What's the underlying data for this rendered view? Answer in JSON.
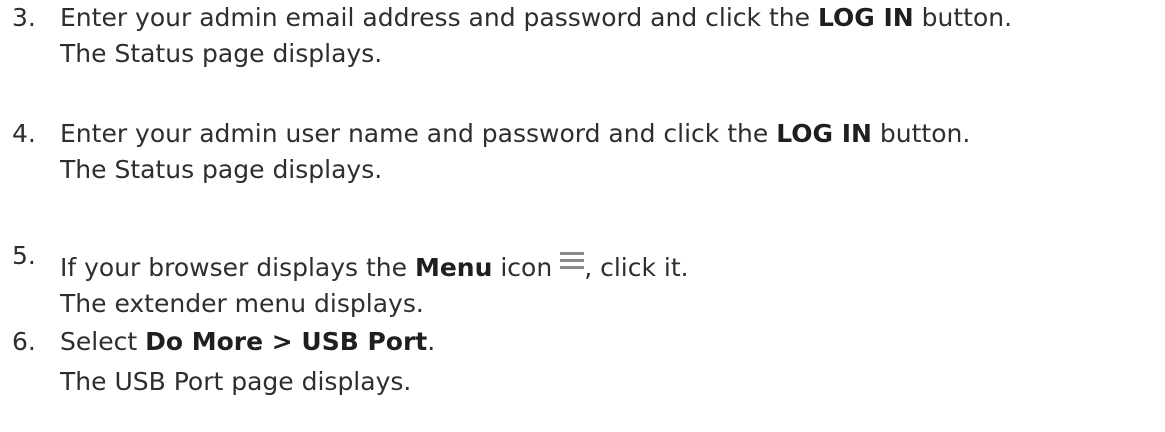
{
  "steps": [
    {
      "number": "3.",
      "line1_before": "Enter your admin email address and password and click the ",
      "line1_bold": "LOG IN",
      "line1_after": " button.",
      "line2": "The Status page displays."
    },
    {
      "number": "4.",
      "line1_before": "Enter your admin user name and password and click the ",
      "line1_bold": "LOG IN",
      "line1_after": " button.",
      "line2": "The Status page displays."
    },
    {
      "number": "5.",
      "line1_before": "If your browser displays the ",
      "line1_bold": "Menu",
      "line1_middle": " icon",
      "icon": "menu-icon",
      "line1_after": ", click it.",
      "line2": "The extender menu displays."
    },
    {
      "number": "6.",
      "line1_before": "Select ",
      "line1_bold": "Do More > USB Port",
      "line1_after": ".",
      "line2": "The USB Port page displays."
    }
  ]
}
